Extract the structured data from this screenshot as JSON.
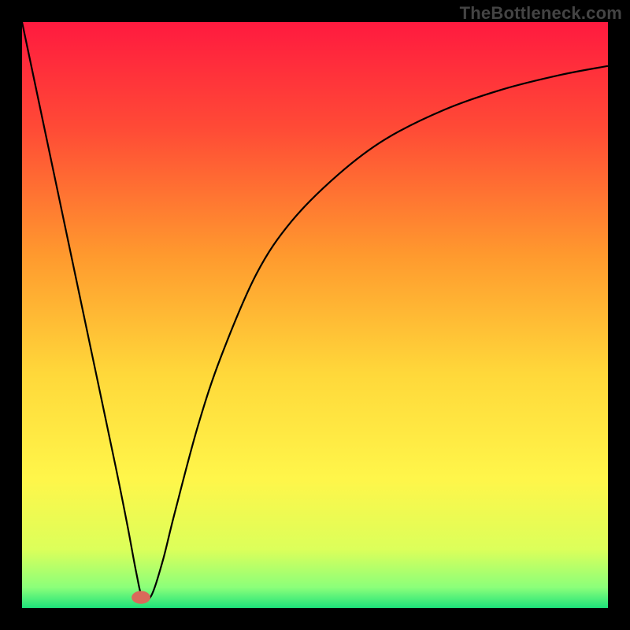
{
  "watermark": "TheBottleneck.com",
  "chart_data": {
    "type": "line",
    "title": "",
    "xlabel": "",
    "ylabel": "",
    "xlim": [
      0,
      100
    ],
    "ylim": [
      0,
      100
    ],
    "axes_visible": false,
    "grid": false,
    "background_gradient": {
      "stops": [
        {
          "offset": 0.0,
          "color": "#ff1a3f"
        },
        {
          "offset": 0.18,
          "color": "#ff4a36"
        },
        {
          "offset": 0.4,
          "color": "#ff9a2e"
        },
        {
          "offset": 0.6,
          "color": "#ffd83a"
        },
        {
          "offset": 0.78,
          "color": "#fff64a"
        },
        {
          "offset": 0.9,
          "color": "#dcff5a"
        },
        {
          "offset": 0.965,
          "color": "#8bff7a"
        },
        {
          "offset": 1.0,
          "color": "#1ee27a"
        }
      ]
    },
    "series": [
      {
        "name": "curve",
        "stroke": "#000000",
        "stroke_width": 2.2,
        "x": [
          0,
          4,
          8,
          12,
          16,
          18,
          19.5,
          20.5,
          22,
          24,
          26,
          30,
          34,
          40,
          46,
          54,
          62,
          72,
          82,
          92,
          100
        ],
        "y": [
          100,
          81,
          62,
          43,
          24,
          14,
          6,
          2,
          2,
          8,
          16,
          31,
          43,
          57,
          66,
          74,
          80,
          85,
          88.5,
          91,
          92.5
        ]
      }
    ],
    "marker": {
      "name": "min-point",
      "x": 20.3,
      "y": 1.8,
      "rx": 1.6,
      "ry": 1.1,
      "fill": "#d96a5a"
    }
  }
}
